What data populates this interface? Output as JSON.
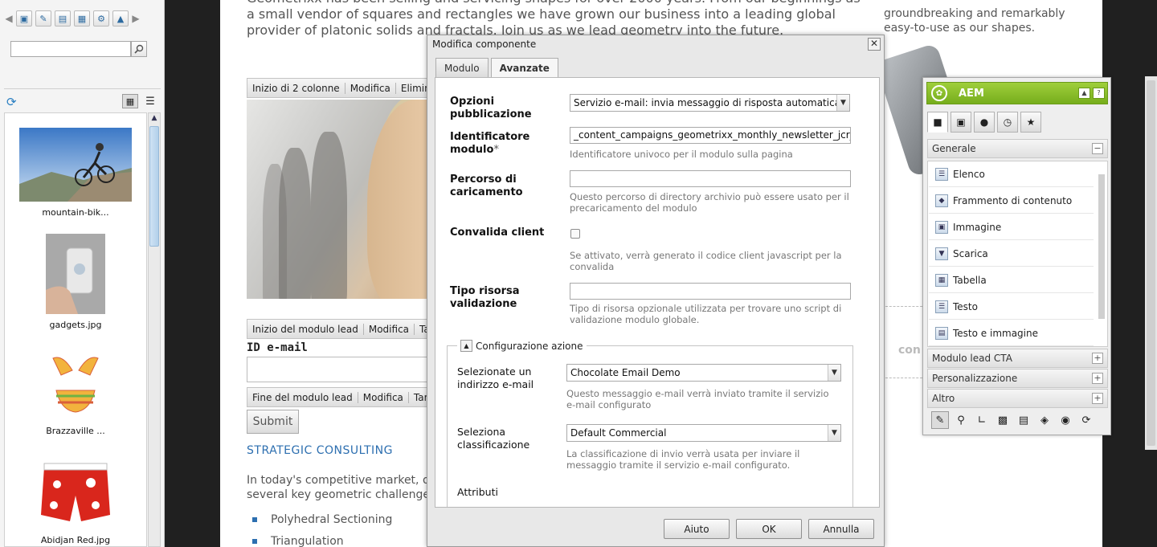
{
  "left_panel": {
    "toolbar_icons": [
      "image-icon",
      "edit-icon",
      "document-icon",
      "layout-icon",
      "settings-icon",
      "export-icon"
    ],
    "search_placeholder": "",
    "assets": [
      {
        "label": "mountain-bik...",
        "thumb": "mountain-bike"
      },
      {
        "label": "gadgets.jpg",
        "thumb": "gadgets"
      },
      {
        "label": "Brazzaville ...",
        "thumb": "bikini"
      },
      {
        "label": "Abidjan Red.jpg",
        "thumb": "shorts"
      }
    ]
  },
  "page": {
    "intro_line1": "a small vendor of squares and rectangles we have grown our business into a leading global",
    "intro_line2": "provider of platonic solids and fractals. Join us as we lead geometry into the future.",
    "intro_top": "Geometrixx has been selling and servicing shapes for over 2000 years. From our beginnings as",
    "right_text_1": "groundbreaking and remarkably",
    "right_text_2": "easy-to-use as our shapes.",
    "bar_columns": [
      "Inizio di 2 colonne",
      "Modifica",
      "Elimina"
    ],
    "bar_lead_start": [
      "Inizio del modulo lead",
      "Modifica",
      "Target"
    ],
    "email_label": "ID e-mail",
    "bar_lead_end": [
      "Fine del modulo lead",
      "Modifica",
      "Target"
    ],
    "submit_label": "Submit",
    "section_title": "STRATEGIC CONSULTING",
    "section_text_1": "In today's competitive market, organ",
    "section_text_2": "several key geometric challenges:",
    "bullets": [
      "Polyhedral Sectioning",
      "Triangulation"
    ],
    "co_text": "con"
  },
  "dialog": {
    "title": "Modifica componente",
    "tabs": [
      "Modulo",
      "Avanzate"
    ],
    "active_tab": "Avanzate",
    "opzioni_label": "Opzioni pubblicazione",
    "opzioni_value": "Servizio e-mail: invia messaggio di risposta automatica",
    "identificatore_label": "Identificatore modulo",
    "identificatore_value": "_content_campaigns_geometrixx_monthly_newsletter_jcr_",
    "identificatore_help": "Identificatore univoco per il modulo sulla pagina",
    "percorso_label": "Percorso di caricamento",
    "percorso_value": "",
    "percorso_help": "Questo percorso di directory archivio può essere usato per il precaricamento del modulo",
    "convalida_label": "Convalida client",
    "convalida_help": "Se attivato, verrà generato il codice client javascript per la convalida",
    "tipo_label": "Tipo risorsa validazione",
    "tipo_value": "",
    "tipo_help": "Tipo di risorsa opzionale utilizzata per trovare uno script di validazione modulo globale.",
    "config_legend": "Configurazione azione",
    "email_label": "Selezionate un indirizzo e-mail",
    "email_value": "Chocolate Email Demo",
    "email_help": "Questo messaggio e-mail verrà inviato tramite il servizio e-mail configurato",
    "class_label": "Seleziona classificazione",
    "class_value": "Default Commercial",
    "class_help": "La classificazione di invio verrà usata per inviare il messaggio tramite il servizio e-mail configurato.",
    "attributi_label": "Attributi",
    "buttons": {
      "help": "Aiuto",
      "ok": "OK",
      "cancel": "Annulla"
    }
  },
  "sidekick": {
    "title": "AEM",
    "group_open": "Generale",
    "items": [
      "Elenco",
      "Frammento di contenuto",
      "Immagine",
      "Scarica",
      "Tabella",
      "Testo",
      "Testo e immagine"
    ],
    "groups_closed": [
      "Modulo lead CTA",
      "Personalizzazione",
      "Altro"
    ]
  }
}
